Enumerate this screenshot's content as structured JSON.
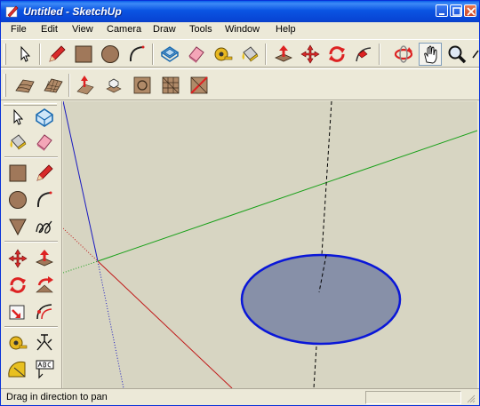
{
  "window": {
    "title": "Untitled - SketchUp"
  },
  "menu": [
    "File",
    "Edit",
    "View",
    "Camera",
    "Draw",
    "Tools",
    "Window",
    "Help"
  ],
  "toolbar_top": [
    "select-icon",
    "pencil-icon",
    "rectangle-icon",
    "circle-icon",
    "arc-icon",
    "offset-icon",
    "eraser-icon",
    "tape-measure-icon",
    "paint-bucket-icon",
    "push-pull-icon",
    "move-icon",
    "rotate-icon",
    "follow-me-icon",
    "orbit-icon",
    "pan-icon",
    "zoom-icon"
  ],
  "toolbar_second": [
    "sandbox-from-contours-icon",
    "sandbox-from-scratch-icon",
    "smoove-icon",
    "stamp-icon",
    "drape-icon",
    "add-detail-icon",
    "flip-edge-icon"
  ],
  "status": {
    "text": "Drag in direction to pan"
  },
  "colors": {
    "viewport_bg": "#d7d5c2",
    "circle_fill": "#8790a8",
    "circle_edge": "#0a17d8",
    "red_axis": "#c01818",
    "green_axis": "#18a018",
    "blue_axis": "#1818c0"
  }
}
